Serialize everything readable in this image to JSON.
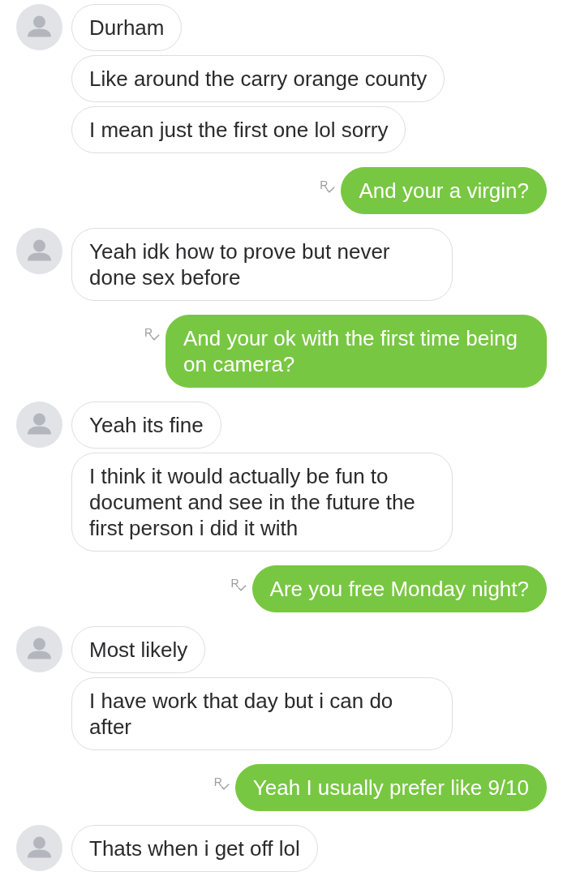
{
  "messages": [
    {
      "kind": "incoming",
      "avatar": true,
      "text": "Durham"
    },
    {
      "kind": "incoming",
      "avatar": false,
      "text": "Like around the carry orange county"
    },
    {
      "kind": "incoming",
      "avatar": false,
      "text": "I mean just the first one lol sorry"
    },
    {
      "kind": "outgoing",
      "receipt": "R",
      "text": "And your a virgin?"
    },
    {
      "kind": "incoming",
      "avatar": true,
      "text": "Yeah idk how to prove but never done sex before"
    },
    {
      "kind": "outgoing",
      "receipt": "R",
      "text": "And your ok with the first time being on camera?"
    },
    {
      "kind": "incoming",
      "avatar": true,
      "text": "Yeah its fine"
    },
    {
      "kind": "incoming",
      "avatar": false,
      "text": "I think it would actually be fun to document and see in the future the first person i did it with"
    },
    {
      "kind": "outgoing",
      "receipt": "R",
      "text": "Are you free Monday night?"
    },
    {
      "kind": "incoming",
      "avatar": true,
      "text": "Most likely"
    },
    {
      "kind": "incoming",
      "avatar": false,
      "text": "I have work that day but i can do after"
    },
    {
      "kind": "outgoing",
      "receipt": "R",
      "text": "Yeah I usually prefer like 9/10"
    },
    {
      "kind": "incoming",
      "avatar": true,
      "text": "Thats when i get off lol"
    }
  ]
}
